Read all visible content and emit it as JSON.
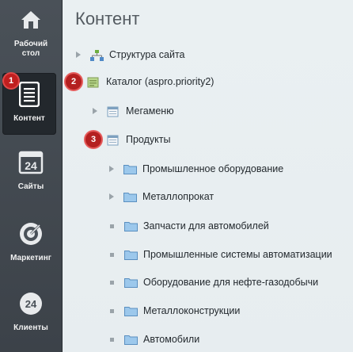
{
  "sidebar": {
    "items": [
      {
        "label": "Рабочий стол",
        "icon": "home-icon"
      },
      {
        "label": "Контент",
        "icon": "document-icon",
        "badge": "1"
      },
      {
        "label": "Сайты",
        "icon": "calendar-icon",
        "icon_text": "24"
      },
      {
        "label": "Маркетинг",
        "icon": "target-icon"
      },
      {
        "label": "Клиенты",
        "icon": "clients-icon",
        "icon_text": "24"
      }
    ]
  },
  "main": {
    "title": "Контент",
    "tree": [
      {
        "label": "Структура сайта",
        "icon": "site-structure-icon"
      },
      {
        "label": "Каталог (aspro.priority2)",
        "icon": "catalog-icon",
        "marker": "2"
      },
      {
        "label": "Мегаменю",
        "icon": "iblock-icon"
      },
      {
        "label": "Продукты",
        "icon": "iblock-icon",
        "marker": "3"
      },
      {
        "label": "Промышленное оборудование",
        "icon": "folder-icon"
      },
      {
        "label": "Металлопрокат",
        "icon": "folder-icon"
      },
      {
        "label": "Запчасти для автомобилей",
        "icon": "folder-icon"
      },
      {
        "label": "Промышленные системы автоматизации",
        "icon": "folder-icon"
      },
      {
        "label": "Оборудование для нефте-газодобычи",
        "icon": "folder-icon"
      },
      {
        "label": "Металлоконструкции",
        "icon": "folder-icon"
      },
      {
        "label": "Автомобили",
        "icon": "folder-icon"
      }
    ]
  },
  "colors": {
    "rail": "#43494f",
    "badge": "#c01f1f",
    "folder": "#8fc1e8"
  }
}
